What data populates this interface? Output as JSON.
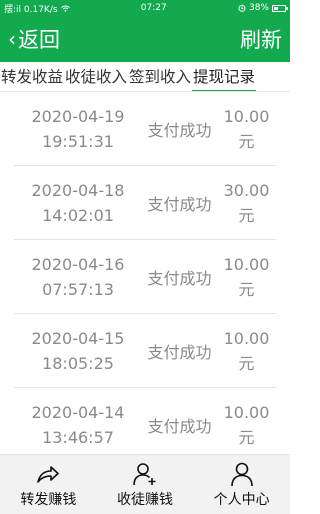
{
  "status_bar": {
    "left_text": "摆:il 0.17K/s",
    "time": "07:27",
    "battery": "38%",
    "icons": [
      "signal-icon",
      "wifi-icon",
      "alarm-icon",
      "battery-icon"
    ]
  },
  "header": {
    "back_label": "返回",
    "refresh_label": "刷新",
    "background_color": "#12a94f"
  },
  "tabs": [
    {
      "label": "转发收益",
      "active": false
    },
    {
      "label": "收徒收入",
      "active": false
    },
    {
      "label": "签到收入",
      "active": false
    },
    {
      "label": "提现记录",
      "active": true
    }
  ],
  "records": [
    {
      "date": "2020-04-19",
      "time": "19:51:31",
      "status": "支付成功",
      "amount": "10.00",
      "unit": "元"
    },
    {
      "date": "2020-04-18",
      "time": "14:02:01",
      "status": "支付成功",
      "amount": "30.00",
      "unit": "元"
    },
    {
      "date": "2020-04-16",
      "time": "07:57:13",
      "status": "支付成功",
      "amount": "10.00",
      "unit": "元"
    },
    {
      "date": "2020-04-15",
      "time": "18:05:25",
      "status": "支付成功",
      "amount": "10.00",
      "unit": "元"
    },
    {
      "date": "2020-04-14",
      "time": "13:46:57",
      "status": "支付成功",
      "amount": "10.00",
      "unit": "元"
    }
  ],
  "bottom_nav": [
    {
      "label": "转发赚钱",
      "icon": "share-icon"
    },
    {
      "label": "收徒赚钱",
      "icon": "add-user-icon"
    },
    {
      "label": "个人中心",
      "icon": "user-icon"
    }
  ]
}
